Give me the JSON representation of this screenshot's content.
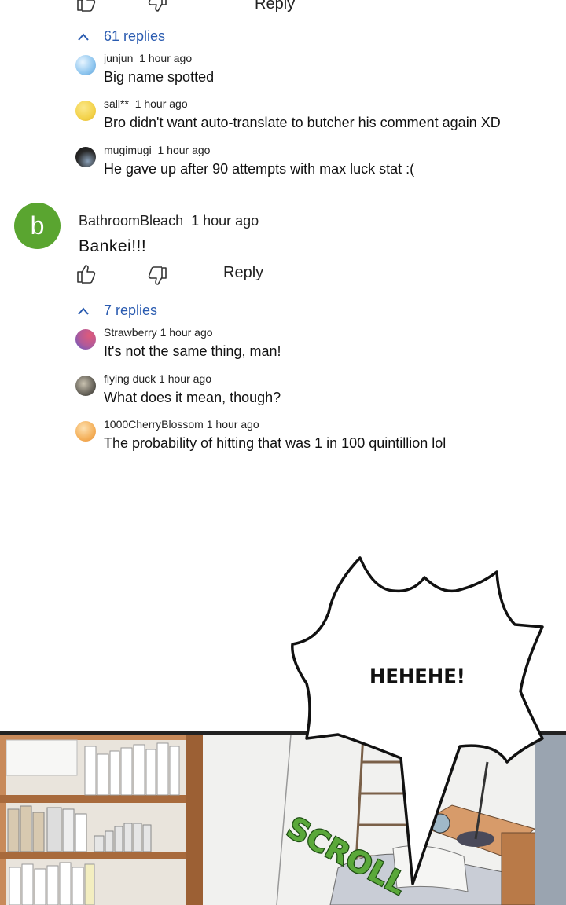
{
  "top_partial": {
    "reply_label": "Reply"
  },
  "thread1": {
    "toggle_label": "61 replies",
    "replies": [
      {
        "user": "junjun",
        "time": "1 hour ago",
        "text": "Big name spotted",
        "avatar_color": "#8fc6ef"
      },
      {
        "user": "sall**",
        "time": "1 hour ago",
        "text": "Bro didn't want auto-translate to butcher his comment again XD",
        "avatar_color": "#f3d24a"
      },
      {
        "user": "mugimugi",
        "time": "1 hour ago",
        "text": "He gave up after 90 attempts with max luck stat :(",
        "avatar_color": "#1e1e1e"
      }
    ]
  },
  "comment": {
    "avatar_letter": "b",
    "avatar_color": "#5aa530",
    "user": "BathroomBleach",
    "time": "1 hour ago",
    "text": "Bankei!!!",
    "reply_label": "Reply"
  },
  "thread2": {
    "toggle_label": "7 replies",
    "replies": [
      {
        "user": "Strawberry",
        "time": "1 hour ago",
        "text": "It's not the same thing, man!",
        "avatar_color": "#b05a9a"
      },
      {
        "user": "flying duck",
        "time": "1 hour ago",
        "text": "What does it mean, though?",
        "avatar_color": "#6e6a60"
      },
      {
        "user": "1000CherryBlossom",
        "time": "1 hour ago",
        "text": "The probability of hitting that was 1 in 100 quintillion lol",
        "avatar_color": "#f4b05a"
      }
    ]
  },
  "comic": {
    "speech_text": "HEHEHE!",
    "sfx_text": "SCROLL"
  }
}
